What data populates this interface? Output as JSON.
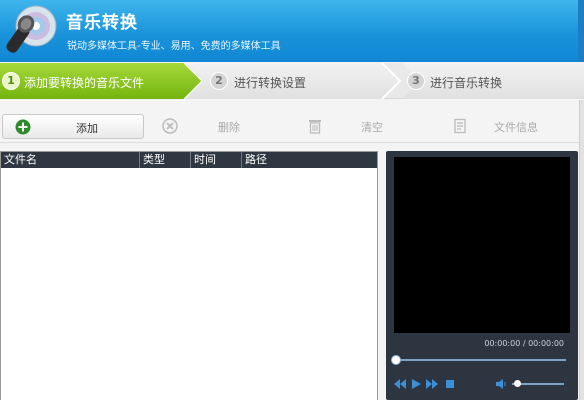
{
  "app": {
    "title": "音乐转换",
    "subtitle": "锐动多媒体工具-专业、易用、免费的多媒体工具"
  },
  "steps": [
    {
      "num": "1",
      "label": "添加要转换的音乐文件",
      "active": true
    },
    {
      "num": "2",
      "label": "进行转换设置",
      "active": false
    },
    {
      "num": "3",
      "label": "进行音乐转换",
      "active": false
    }
  ],
  "toolbar": {
    "add": "添加",
    "delete": "删除",
    "clear": "清空",
    "info": "文件信息"
  },
  "file_list": {
    "columns": [
      "文件名",
      "类型",
      "时间",
      "路径"
    ],
    "rows": []
  },
  "player": {
    "time": "00:00:00 / 00:00:00",
    "seek_fraction": 0,
    "volume_fraction": 0.1
  },
  "colors": {
    "header": "#1a93db",
    "step_active": "#8ac51f",
    "list_header": "#2e3742",
    "player_bg": "#2d3640"
  }
}
